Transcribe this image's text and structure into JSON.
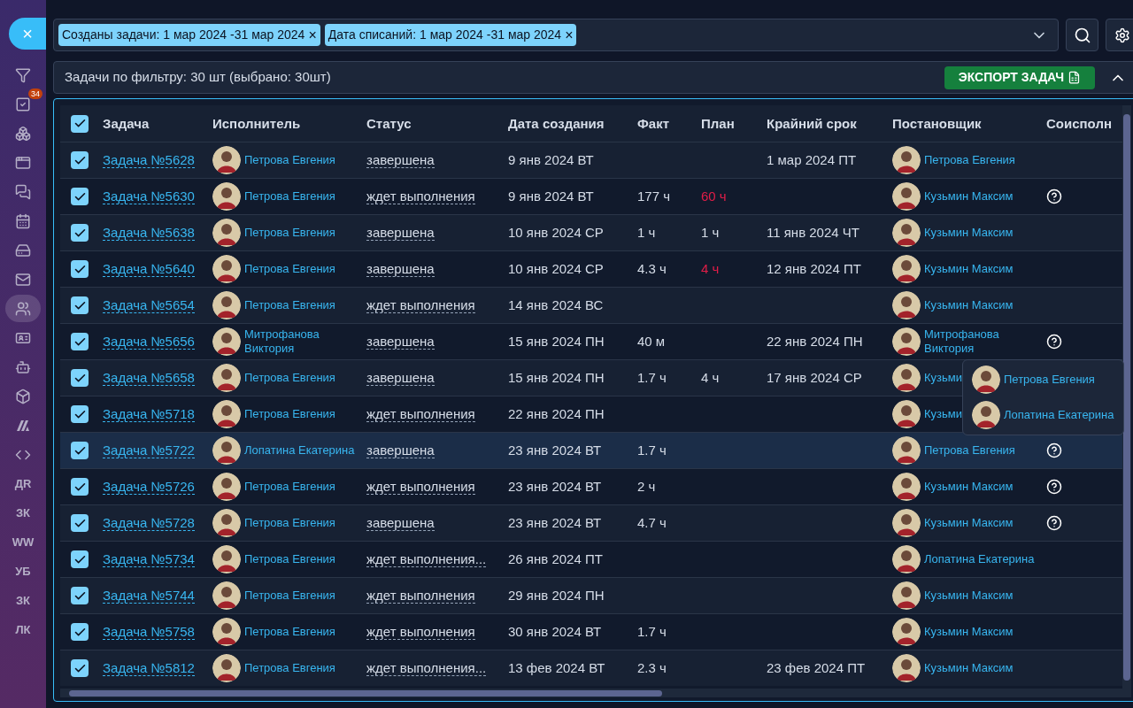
{
  "sidebar": {
    "close": "×",
    "items": [
      {
        "kind": "icon",
        "selected": false
      },
      {
        "kind": "icon",
        "badge": "34",
        "selected": false
      },
      {
        "kind": "icon",
        "selected": false
      },
      {
        "kind": "icon",
        "selected": false
      },
      {
        "kind": "icon",
        "selected": false
      },
      {
        "kind": "icon",
        "selected": false
      },
      {
        "kind": "icon",
        "selected": false
      },
      {
        "kind": "icon",
        "selected": false
      },
      {
        "kind": "icon",
        "selected": true
      },
      {
        "kind": "icon",
        "selected": false
      },
      {
        "kind": "icon",
        "selected": false
      },
      {
        "kind": "icon",
        "selected": false
      },
      {
        "kind": "icon",
        "selected": false
      },
      {
        "kind": "icon",
        "selected": false
      },
      {
        "kind": "text",
        "label": "ДR",
        "selected": false
      },
      {
        "kind": "text",
        "label": "ЗК",
        "selected": false
      },
      {
        "kind": "text",
        "label": "WW",
        "selected": false
      },
      {
        "kind": "text",
        "label": "УБ",
        "selected": false
      },
      {
        "kind": "text",
        "label": "ЗК",
        "selected": false
      },
      {
        "kind": "text",
        "label": "ЛК",
        "selected": false
      }
    ]
  },
  "filter": {
    "chips": [
      {
        "label": "Созданы задачи: 1 мар 2024 -31 мар 2024",
        "remove": "×"
      },
      {
        "label": "Дата списаний: 1 мар 2024 -31 мар 2024",
        "remove": "×"
      }
    ]
  },
  "summary": {
    "text": "Задачи по фильтру: 30 шт (выбрано: 30шт)",
    "export": "ЭКСПОРТ ЗАДАЧ",
    "expanded": true
  },
  "table": {
    "all_checked": true,
    "columns": [
      "Задача",
      "Исполнитель",
      "Статус",
      "Дата создания",
      "Факт",
      "План",
      "Крайний срок",
      "Постановщик",
      "Соисполн"
    ],
    "rows": [
      {
        "checked": true,
        "highlighted": false,
        "task": "Задача №5628",
        "executor": "Петрова Евгения",
        "status": "завершена",
        "created": "9 янв 2024 ВТ",
        "fact": "",
        "plan": "",
        "deadline": "1 мар 2024 ПТ",
        "setter": "Петрова Евгения",
        "co": false
      },
      {
        "checked": true,
        "highlighted": false,
        "task": "Задача №5630",
        "executor": "Петрова Евгения",
        "status": "ждет выполнения",
        "created": "9 янв 2024 ВТ",
        "fact": "177 ч",
        "plan": "60 ч",
        "plan_overdue": true,
        "deadline": "",
        "setter": "Кузьмин Максим",
        "co": true
      },
      {
        "checked": true,
        "highlighted": false,
        "task": "Задача №5638",
        "executor": "Петрова Евгения",
        "status": "завершена",
        "created": "10 янв 2024 СР",
        "fact": "1 ч",
        "plan": "1 ч",
        "plan_overdue": false,
        "deadline": "11 янв 2024 ЧТ",
        "setter": "Кузьмин Максим",
        "co": false
      },
      {
        "checked": true,
        "highlighted": false,
        "task": "Задача №5640",
        "executor": "Петрова Евгения",
        "status": "завершена",
        "created": "10 янв 2024 СР",
        "fact": "4.3 ч",
        "plan": "4 ч",
        "plan_overdue": true,
        "deadline": "12 янв 2024 ПТ",
        "setter": "Кузьмин Максим",
        "co": false
      },
      {
        "checked": true,
        "highlighted": false,
        "task": "Задача №5654",
        "executor": "Петрова Евгения",
        "status": "ждет выполнения",
        "created": "14 янв 2024 ВС",
        "fact": "",
        "plan": "",
        "deadline": "",
        "setter": "Кузьмин Максим",
        "co": false
      },
      {
        "checked": true,
        "highlighted": false,
        "task": "Задача №5656",
        "executor": "Митрофанова Виктория",
        "status": "завершена",
        "created": "15 янв 2024 ПН",
        "fact": "40 м",
        "plan": "",
        "deadline": "22 янв 2024 ПН",
        "setter": "Митрофанова Виктория",
        "co": true
      },
      {
        "checked": true,
        "highlighted": false,
        "task": "Задача №5658",
        "executor": "Петрова Евгения",
        "status": "завершена",
        "created": "15 янв 2024 ПН",
        "fact": "1.7 ч",
        "plan": "4 ч",
        "plan_overdue": false,
        "deadline": "17 янв 2024 СР",
        "setter": "Кузьми",
        "co": false
      },
      {
        "checked": true,
        "highlighted": false,
        "task": "Задача №5718",
        "executor": "Петрова Евгения",
        "status": "ждет выполнения",
        "created": "22 янв 2024 ПН",
        "fact": "",
        "plan": "",
        "deadline": "",
        "setter": "Кузьми",
        "co": false
      },
      {
        "checked": true,
        "highlighted": true,
        "task": "Задача №5722",
        "executor": "Лопатина Екатерина",
        "status": "завершена",
        "created": "23 янв 2024 ВТ",
        "fact": "1.7 ч",
        "plan": "",
        "deadline": "",
        "setter": "Петрова Евгения",
        "co": true
      },
      {
        "checked": true,
        "highlighted": false,
        "task": "Задача №5726",
        "executor": "Петрова Евгения",
        "status": "ждет выполнения",
        "created": "23 янв 2024 ВТ",
        "fact": "2 ч",
        "plan": "",
        "deadline": "",
        "setter": "Кузьмин Максим",
        "co": true
      },
      {
        "checked": true,
        "highlighted": false,
        "task": "Задача №5728",
        "executor": "Петрова Евгения",
        "status": "завершена",
        "created": "23 янв 2024 ВТ",
        "fact": "4.7 ч",
        "plan": "",
        "deadline": "",
        "setter": "Кузьмин Максим",
        "co": true
      },
      {
        "checked": true,
        "highlighted": false,
        "task": "Задача №5734",
        "executor": "Петрова Евгения",
        "status": "ждет выполнения...",
        "created": "26 янв 2024 ПТ",
        "fact": "",
        "plan": "",
        "deadline": "",
        "setter": "Лопатина Екатерина",
        "co": false
      },
      {
        "checked": true,
        "highlighted": false,
        "task": "Задача №5744",
        "executor": "Петрова Евгения",
        "status": "ждет выполнения",
        "created": "29 янв 2024 ПН",
        "fact": "",
        "plan": "",
        "deadline": "",
        "setter": "Кузьмин Максим",
        "co": false
      },
      {
        "checked": true,
        "highlighted": false,
        "task": "Задача №5758",
        "executor": "Петрова Евгения",
        "status": "ждет выполнения",
        "created": "30 янв 2024 ВТ",
        "fact": "1.7 ч",
        "plan": "",
        "deadline": "",
        "setter": "Кузьмин Максим",
        "co": false
      },
      {
        "checked": true,
        "highlighted": false,
        "task": "Задача №5812",
        "executor": "Петрова Евгения",
        "status": "ждет выполнения...",
        "created": "13 фев 2024 ВТ",
        "fact": "2.3 ч",
        "plan": "",
        "deadline": "23 фев 2024 ПТ",
        "setter": "Кузьмин Максим",
        "co": false
      }
    ]
  },
  "popup": {
    "people": [
      "Петрова Евгения",
      "Лопатина Екатерина"
    ]
  }
}
